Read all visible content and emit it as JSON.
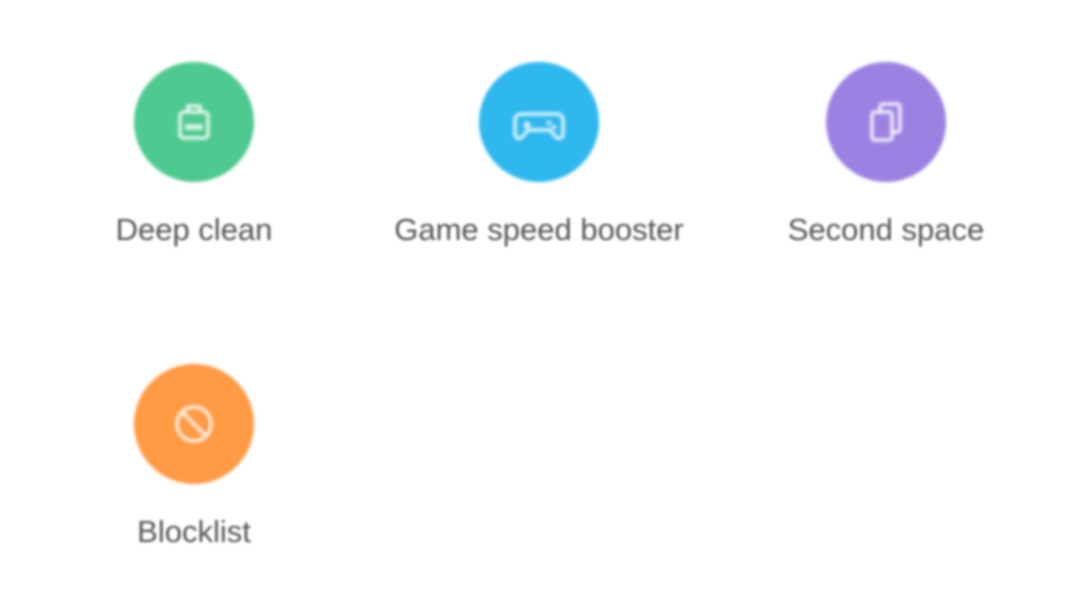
{
  "tiles": [
    {
      "label": "Deep clean",
      "color": "#4ec98f",
      "icon": "bag-icon"
    },
    {
      "label": "Game speed booster",
      "color": "#2fb8ee",
      "icon": "gamepad-icon"
    },
    {
      "label": "Second space",
      "color": "#9b82e2",
      "icon": "cards-icon"
    },
    {
      "label": "Blocklist",
      "color": "#ff9a45",
      "icon": "block-icon"
    }
  ]
}
